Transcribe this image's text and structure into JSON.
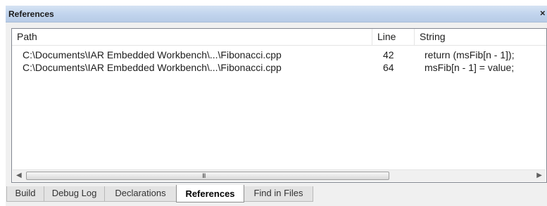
{
  "window": {
    "title": "References",
    "close_glyph": "×"
  },
  "columns": {
    "path": "Path",
    "line": "Line",
    "string": "String"
  },
  "rows": [
    {
      "path": "C:\\Documents\\IAR Embedded Workbench\\...\\Fibonacci.cpp",
      "line": "42",
      "string": "return (msFib[n - 1]);"
    },
    {
      "path": "C:\\Documents\\IAR Embedded Workbench\\...\\Fibonacci.cpp",
      "line": "64",
      "string": "msFib[n - 1] = value;"
    }
  ],
  "scrollbar": {
    "left_arrow": "◀",
    "right_arrow": "▶",
    "grip": "III"
  },
  "tabs": [
    {
      "label": "Build"
    },
    {
      "label": "Debug Log"
    },
    {
      "label": "Declarations"
    },
    {
      "label": "References",
      "active": true
    },
    {
      "label": "Find in Files"
    }
  ],
  "colors": {
    "titlebar": "#c2d5ee",
    "panel": "#f0f0f0"
  }
}
